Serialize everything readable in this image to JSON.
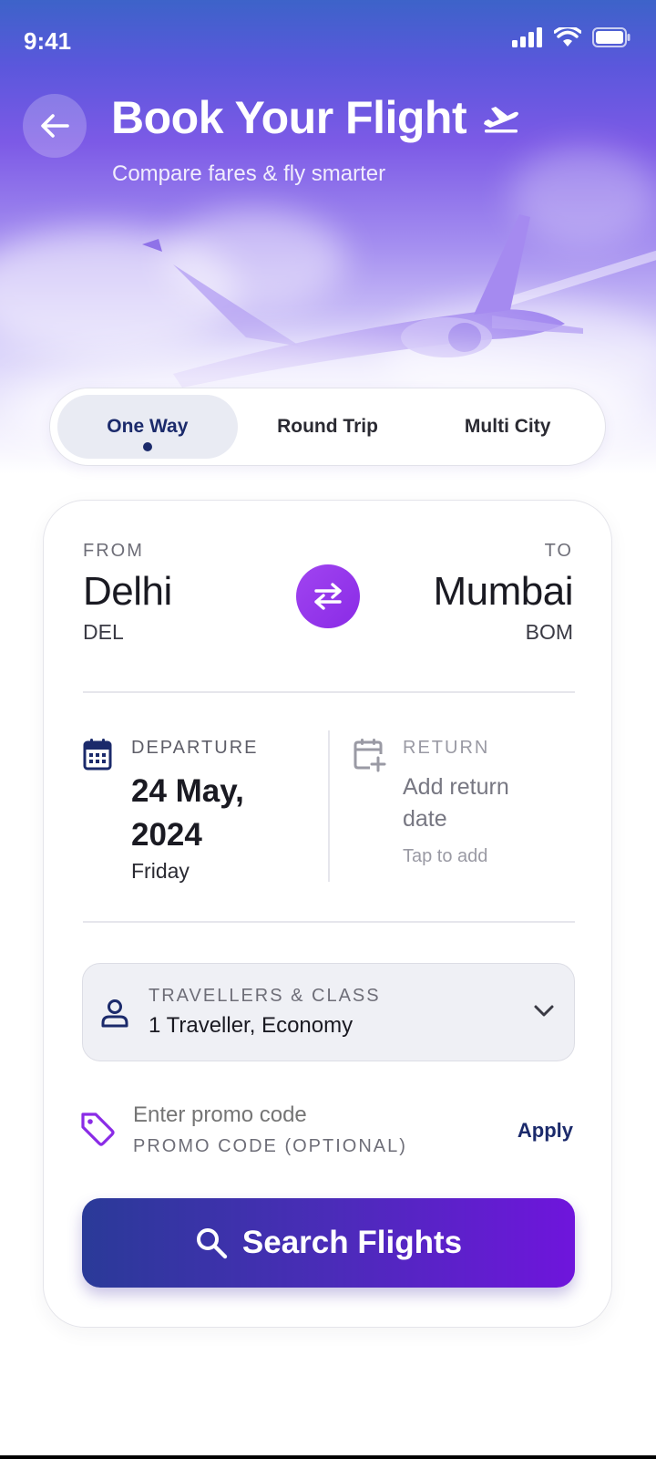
{
  "status_bar": {
    "time": "9:41"
  },
  "header": {
    "title": "Book Your Flight",
    "subtitle": "Compare fares & fly smarter"
  },
  "trip_tabs": [
    {
      "label": "One Way",
      "active": true
    },
    {
      "label": "Round Trip",
      "active": false
    },
    {
      "label": "Multi City",
      "active": false
    }
  ],
  "route": {
    "from_label": "FROM",
    "from_city": "Delhi",
    "from_code": "DEL",
    "to_label": "TO",
    "to_city": "Mumbai",
    "to_code": "BOM"
  },
  "departure": {
    "label": "DEPARTURE",
    "date": "24 May, 2024",
    "day": "Friday"
  },
  "return": {
    "label": "RETURN",
    "value": "Add return date",
    "hint": "Tap to add"
  },
  "travellers": {
    "label": "TRAVELLERS & CLASS",
    "value": "1 Traveller, Economy"
  },
  "promo": {
    "placeholder": "Enter promo code",
    "label": "PROMO CODE (OPTIONAL)",
    "apply_label": "Apply"
  },
  "search_button": {
    "label": "Search Flights"
  },
  "colors": {
    "accent_purple": "#8a2be6",
    "navy": "#1b2a6b",
    "button_gradient_start": "#2a3a98",
    "button_gradient_end": "#6f15dc"
  },
  "icons": [
    "back-arrow-icon",
    "airplane-departure-icon",
    "swap-icon",
    "calendar-icon",
    "calendar-add-icon",
    "person-icon",
    "chevron-down-icon",
    "tag-icon",
    "search-icon",
    "signal-icon",
    "wifi-icon",
    "battery-icon"
  ]
}
